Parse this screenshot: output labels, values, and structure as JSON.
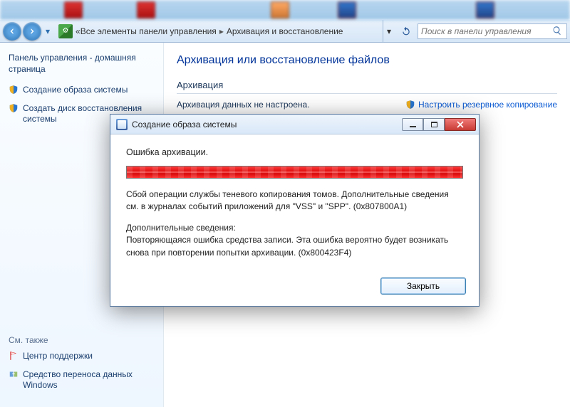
{
  "nav": {
    "crumb_root": "Все элементы панели управления",
    "crumb_current": "Архивация и восстановление",
    "search_placeholder": "Поиск в панели управления"
  },
  "sidebar": {
    "home": "Панель управления - домашняя страница",
    "item_create_image": "Создание образа системы",
    "item_create_disc": "Создать диск восстановления системы",
    "see_also_label": "См. также",
    "see_also_1": "Центр поддержки",
    "see_also_2": "Средство переноса данных Windows"
  },
  "main": {
    "title": "Архивация или восстановление файлов",
    "section_backup": "Архивация",
    "backup_not_configured": "Архивация данных не настроена.",
    "configure_link": "Настроить резервное копирование"
  },
  "dialog": {
    "title": "Создание образа системы",
    "error_heading": "Ошибка архивации.",
    "msg1": "Сбой операции службы теневого копирования томов. Дополнительные сведения см. в журналах событий приложений для \"VSS\" и \"SPP\". (0x807800A1)",
    "add_label": "Дополнительные сведения:",
    "msg2": "Повторяющаяся ошибка средства записи.  Эта ошибка вероятно будет возникать снова при повторении попытки архивации. (0x800423F4)",
    "close_btn": "Закрыть"
  }
}
